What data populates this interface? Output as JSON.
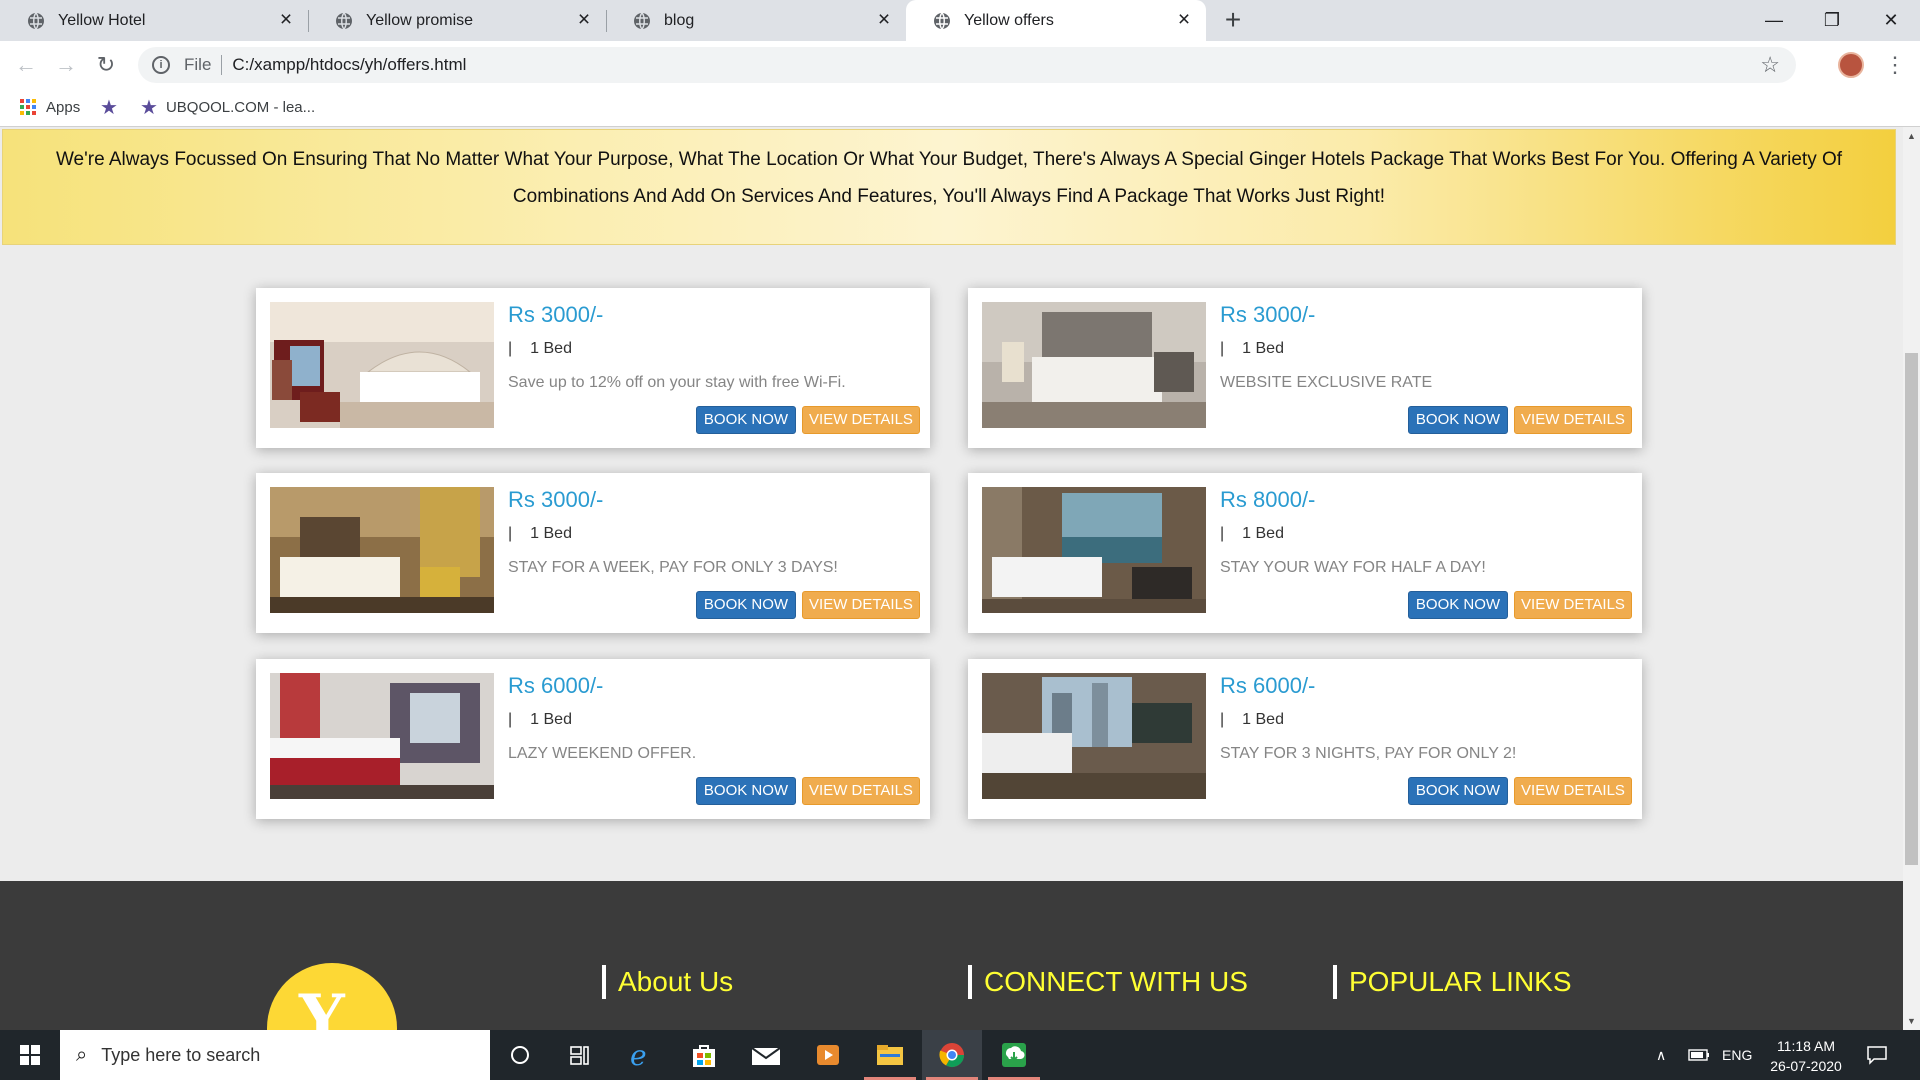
{
  "browser": {
    "tabs": [
      {
        "title": "Yellow Hotel",
        "active": false
      },
      {
        "title": "Yellow promise",
        "active": false
      },
      {
        "title": "blog",
        "active": false
      },
      {
        "title": "Yellow offers",
        "active": true
      }
    ],
    "new_tab": "+",
    "window": {
      "minimize": "—",
      "maximize": "❐",
      "close": "✕"
    },
    "address": {
      "scheme_label": "File",
      "url": "C:/xampp/htdocs/yh/offers.html"
    },
    "bookmarks": [
      {
        "label": "Apps",
        "icon": "apps-grid-icon"
      },
      {
        "label": "",
        "icon": "bookmark-star-icon"
      },
      {
        "label": "UBQOOL.COM - lea...",
        "icon": "bookmark-star-icon"
      }
    ]
  },
  "page": {
    "banner_text": "We're Always Focussed On Ensuring That No Matter What Your Purpose, What The Location Or What Your Budget, There's Always A Special Ginger Hotels Package That Works Best For You. Offering A Variety Of Combinations And Add On Services And Features, You'll Always Find A Package That Works Just Right!",
    "offers": [
      {
        "price": "Rs 3000/-",
        "pipe": "|",
        "beds": "1 Bed",
        "description": "Save up to 12% off on your stay with free Wi-Fi.",
        "book_label": "BOOK NOW",
        "view_label": "VIEW DETAILS"
      },
      {
        "price": "Rs 3000/-",
        "pipe": "|",
        "beds": "1 Bed",
        "description": "WEBSITE EXCLUSIVE RATE",
        "book_label": "BOOK NOW",
        "view_label": "VIEW DETAILS"
      },
      {
        "price": "Rs 3000/-",
        "pipe": "|",
        "beds": "1 Bed",
        "description": "STAY FOR A WEEK, PAY FOR ONLY 3 DAYS!",
        "book_label": "BOOK NOW",
        "view_label": "VIEW DETAILS"
      },
      {
        "price": "Rs 8000/-",
        "pipe": "|",
        "beds": "1 Bed",
        "description": "STAY YOUR WAY FOR HALF A DAY!",
        "book_label": "BOOK NOW",
        "view_label": "VIEW DETAILS"
      },
      {
        "price": "Rs 6000/-",
        "pipe": "|",
        "beds": "1 Bed",
        "description": "LAZY WEEKEND OFFER.",
        "book_label": "BOOK NOW",
        "view_label": "VIEW DETAILS"
      },
      {
        "price": "Rs 6000/-",
        "pipe": "|",
        "beds": "1 Bed",
        "description": "STAY FOR 3 NIGHTS, PAY FOR ONLY 2!",
        "book_label": "BOOK NOW",
        "view_label": "VIEW DETAILS"
      }
    ],
    "footer": {
      "logo_letter": "Y",
      "headings": [
        "About Us",
        "CONNECT WITH US",
        "POPULAR LINKS"
      ]
    }
  },
  "taskbar": {
    "search_placeholder": "Type here to search",
    "apps": [
      "cortana-icon",
      "task-view-icon",
      "edge-icon",
      "store-icon",
      "mail-icon",
      "media-player-icon",
      "file-explorer-icon",
      "chrome-icon",
      "download-app-icon"
    ],
    "language": "ENG",
    "time": "11:18 AM",
    "date": "26-07-2020"
  },
  "colors": {
    "price": "#2a9bd1",
    "book_button": "#2b72b8",
    "view_button": "#f0ac4e",
    "footer_heading": "#ffff33",
    "logo": "#fdd835"
  }
}
